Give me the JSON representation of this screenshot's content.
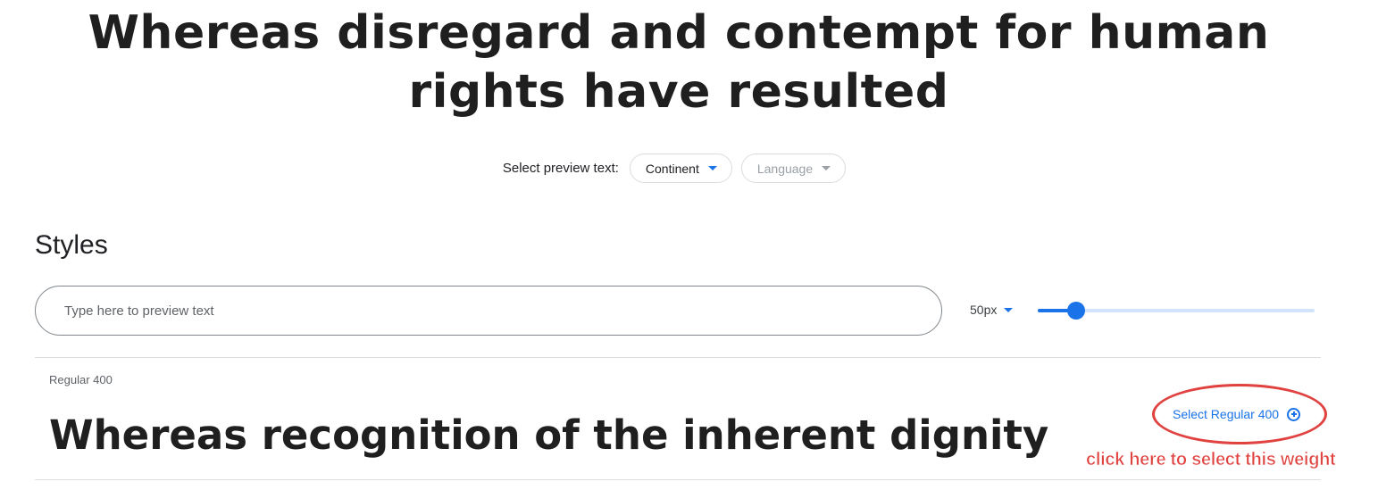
{
  "hero": {
    "preview_text": "Whereas disregard and contempt for human rights have resulted"
  },
  "preview_controls": {
    "label": "Select preview text:",
    "continent_chip": "Continent",
    "language_chip": "Language"
  },
  "styles": {
    "heading": "Styles",
    "input_placeholder": "Type here to preview text",
    "size_label": "50px",
    "slider_level": 0.14
  },
  "style_rows": [
    {
      "label": "Regular 400",
      "sample": "Whereas recognition of the inherent dignity",
      "select_label": "Select Regular 400"
    }
  ],
  "annotation": {
    "note": "click here to select this weight"
  },
  "colors": {
    "accent": "#1a73e8",
    "annotation_red": "#e0423f"
  },
  "icons": {
    "dropdown": "chevron-down-icon",
    "add": "plus-circle-icon"
  }
}
